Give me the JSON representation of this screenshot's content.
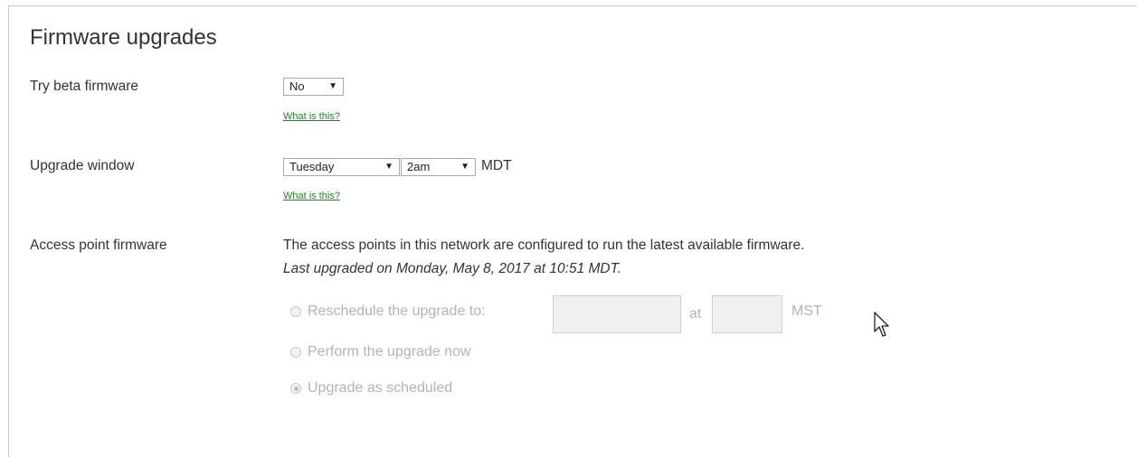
{
  "section": {
    "title": "Firmware upgrades"
  },
  "beta": {
    "label": "Try beta firmware",
    "selected": "No",
    "help_link": "What is this?"
  },
  "window": {
    "label": "Upgrade window",
    "day_selected": "Tuesday",
    "time_selected": "2am",
    "timezone": "MDT",
    "help_link": "What is this?"
  },
  "ap_firmware": {
    "label": "Access point firmware",
    "description": "The access points in this network are configured to run the latest available firmware.",
    "last_upgraded": "Last upgraded on Monday, May 8, 2017 at 10:51 MDT.",
    "options": {
      "reschedule_label": "Reschedule the upgrade to:",
      "at_label": "at",
      "reschedule_tz": "MST",
      "now_label": "Perform the upgrade now",
      "scheduled_label": "Upgrade as scheduled"
    },
    "selected_option": "scheduled"
  },
  "icons": {
    "dropdown": "triangle-down-icon",
    "cursor": "mouse-pointer-icon"
  }
}
